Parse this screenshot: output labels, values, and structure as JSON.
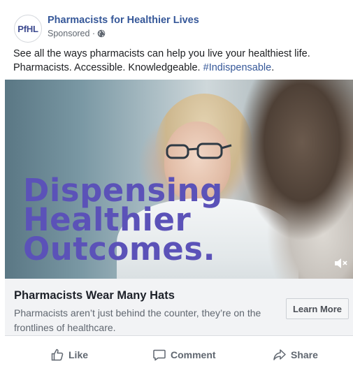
{
  "post": {
    "avatar_text": "PfHL",
    "page_name": "Pharmacists for Healthier Lives",
    "sponsored": "Sponsored ·",
    "text": "See all the ways pharmacists can help you live your healthiest life. Pharmacists. Accessible. Knowledgeable.",
    "hashtag": "#Indispensable",
    "text_end": "."
  },
  "media": {
    "headline_lines": [
      "Dispensing",
      "Healthier",
      "Outcomes."
    ],
    "headline_color": "#5b52b8",
    "mute_icon": "speaker-muted-icon"
  },
  "card": {
    "title": "Pharmacists Wear Many Hats",
    "description": "Pharmacists aren’t just behind the counter, they’re on the frontlines of healthcare.",
    "button_label": "Learn More"
  },
  "actions": {
    "like": "Like",
    "comment": "Comment",
    "share": "Share"
  },
  "colors": {
    "link_blue": "#365899",
    "muted_text": "#606770",
    "card_bg": "#f2f3f5"
  }
}
